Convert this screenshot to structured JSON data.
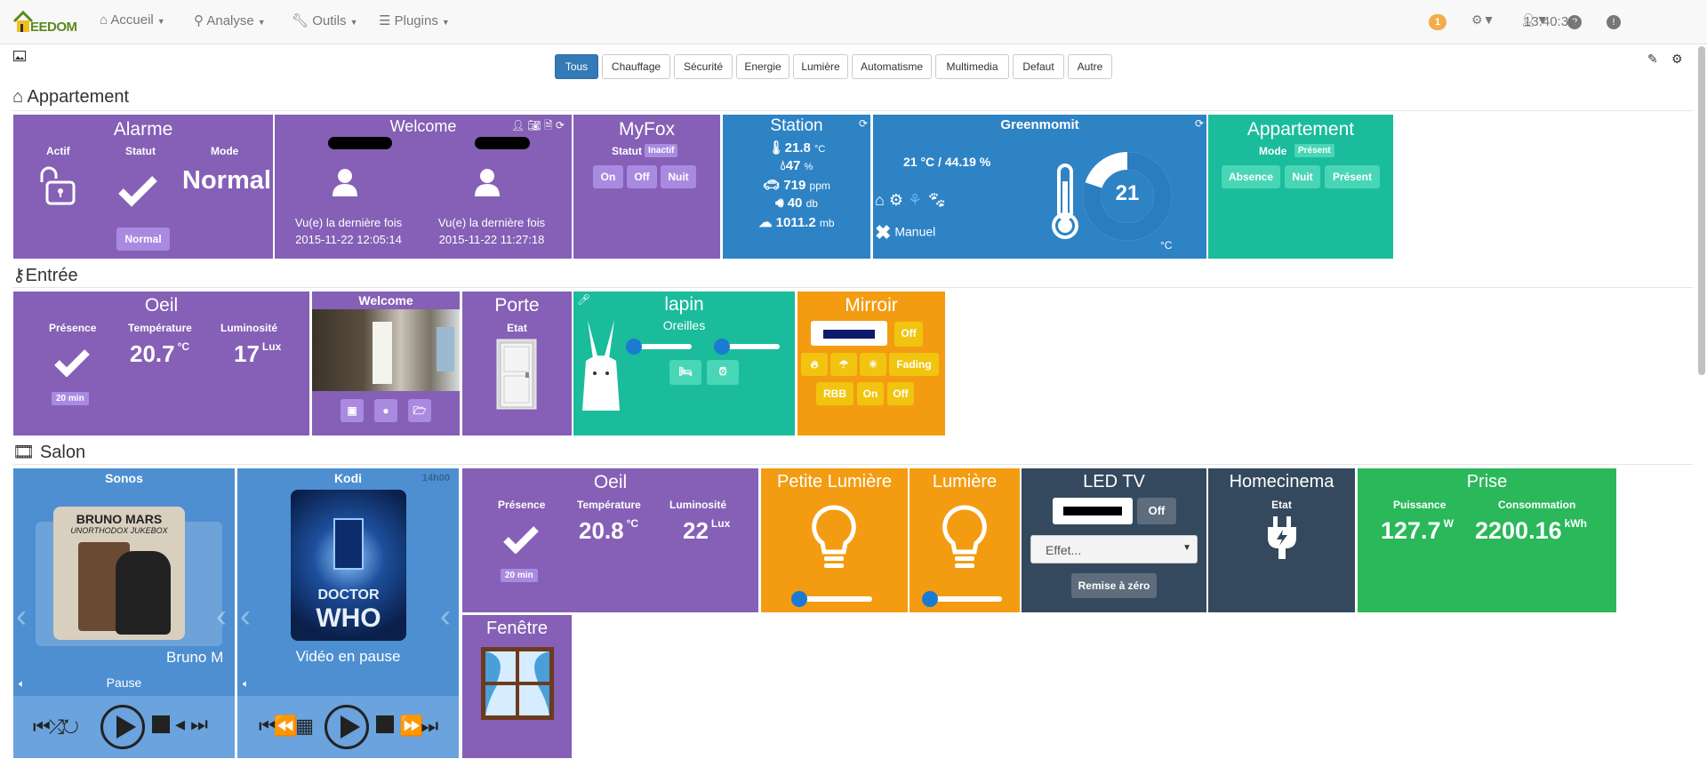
{
  "nav": {
    "brand": "EEDOM",
    "menus": [
      "Accueil",
      "Analyse",
      "Outils",
      "Plugins"
    ],
    "notifications": "1",
    "time": "13:40:36"
  },
  "filters": [
    "Tous",
    "Chauffage",
    "Sécurité",
    "Energie",
    "Lumière",
    "Automatisme",
    "Multimedia",
    "Defaut",
    "Autre"
  ],
  "active_filter": "Tous",
  "sections": {
    "appartement": {
      "title": "Appartement",
      "alarme": {
        "title": "Alarme",
        "actif": "Actif",
        "statut": "Statut",
        "mode": "Mode",
        "mode_value": "Normal",
        "button": "Normal"
      },
      "welcome": {
        "title": "Welcome",
        "seen1": "Vu(e) la dernière fois",
        "date1": "2015-11-22 12:05:14",
        "seen2": "Vu(e) la dernière fois",
        "date2": "2015-11-22 11:27:18"
      },
      "myfox": {
        "title": "MyFox",
        "statut": "Statut",
        "badge": "Inactif",
        "buttons": [
          "On",
          "Off",
          "Nuit"
        ]
      },
      "station": {
        "title": "Station",
        "temp": "21.8",
        "temp_unit": "°C",
        "humidity": "47",
        "hum_unit": "%",
        "co2": "719",
        "co2_unit": "ppm",
        "noise": "40",
        "noise_unit": "db",
        "pressure": "1011.2",
        "pressure_unit": "mb"
      },
      "greenmomit": {
        "title": "Greenmomit",
        "reading": "21 °C / 44.19 %",
        "mode": "Manuel",
        "setpoint": "21",
        "unit": "°C",
        "gauge_fraction": 0.8
      },
      "appartement_mode": {
        "title": "Appartement",
        "mode_label": "Mode",
        "badge": "Présent",
        "buttons": [
          "Absence",
          "Nuit",
          "Présent"
        ]
      }
    },
    "entree": {
      "title": "Entrée",
      "oeil": {
        "title": "Oeil",
        "presence": "Présence",
        "temperature": "Température",
        "luminosite": "Luminosité",
        "temp_value": "20.7",
        "temp_unit": "°C",
        "lum_value": "17",
        "lum_unit": "Lux",
        "badge": "20 min"
      },
      "welcome": {
        "title": "Welcome"
      },
      "porte": {
        "title": "Porte",
        "etat": "Etat"
      },
      "lapin": {
        "title": "lapin",
        "oreilles": "Oreilles"
      },
      "miroir": {
        "title": "Mirroir",
        "off": "Off",
        "fading": "Fading",
        "rbb": "RBB",
        "on": "On",
        "off2": "Off"
      }
    },
    "salon": {
      "title": "Salon",
      "sonos": {
        "title": "Sonos",
        "artist": "Bruno M",
        "status": "Pause",
        "album_line1": "BRUNO MARS",
        "album_line2": "UNORTHODOX JUKEBOX"
      },
      "kodi": {
        "title": "Kodi",
        "time": "14h00",
        "status": "Vidéo en pause",
        "poster_line1": "DOCTOR",
        "poster_line2": "WHO"
      },
      "oeil": {
        "title": "Oeil",
        "presence": "Présence",
        "temperature": "Température",
        "luminosite": "Luminosité",
        "temp_value": "20.8",
        "temp_unit": "°C",
        "lum_value": "22",
        "lum_unit": "Lux",
        "badge": "20 min"
      },
      "petite_lumiere": {
        "title": "Petite Lumière"
      },
      "lumiere": {
        "title": "Lumière"
      },
      "led_tv": {
        "title": "LED TV",
        "off": "Off",
        "select": "Effet...",
        "reset": "Remise à zéro"
      },
      "homecinema": {
        "title": "Homecinema",
        "etat": "Etat"
      },
      "prise": {
        "title": "Prise",
        "puissance": "Puissance",
        "consommation": "Consommation",
        "power": "127.7",
        "power_unit": "W",
        "energy": "2200.16",
        "energy_unit": "kWh"
      },
      "fenetre": {
        "title": "Fenêtre"
      }
    }
  },
  "colors": {
    "purple": "#8560b6",
    "blue": "#2e83c5",
    "teal": "#1abc9c",
    "orange": "#f39c12",
    "navy": "#34495e",
    "green": "#2ab85a",
    "accent": "#337ab7"
  }
}
